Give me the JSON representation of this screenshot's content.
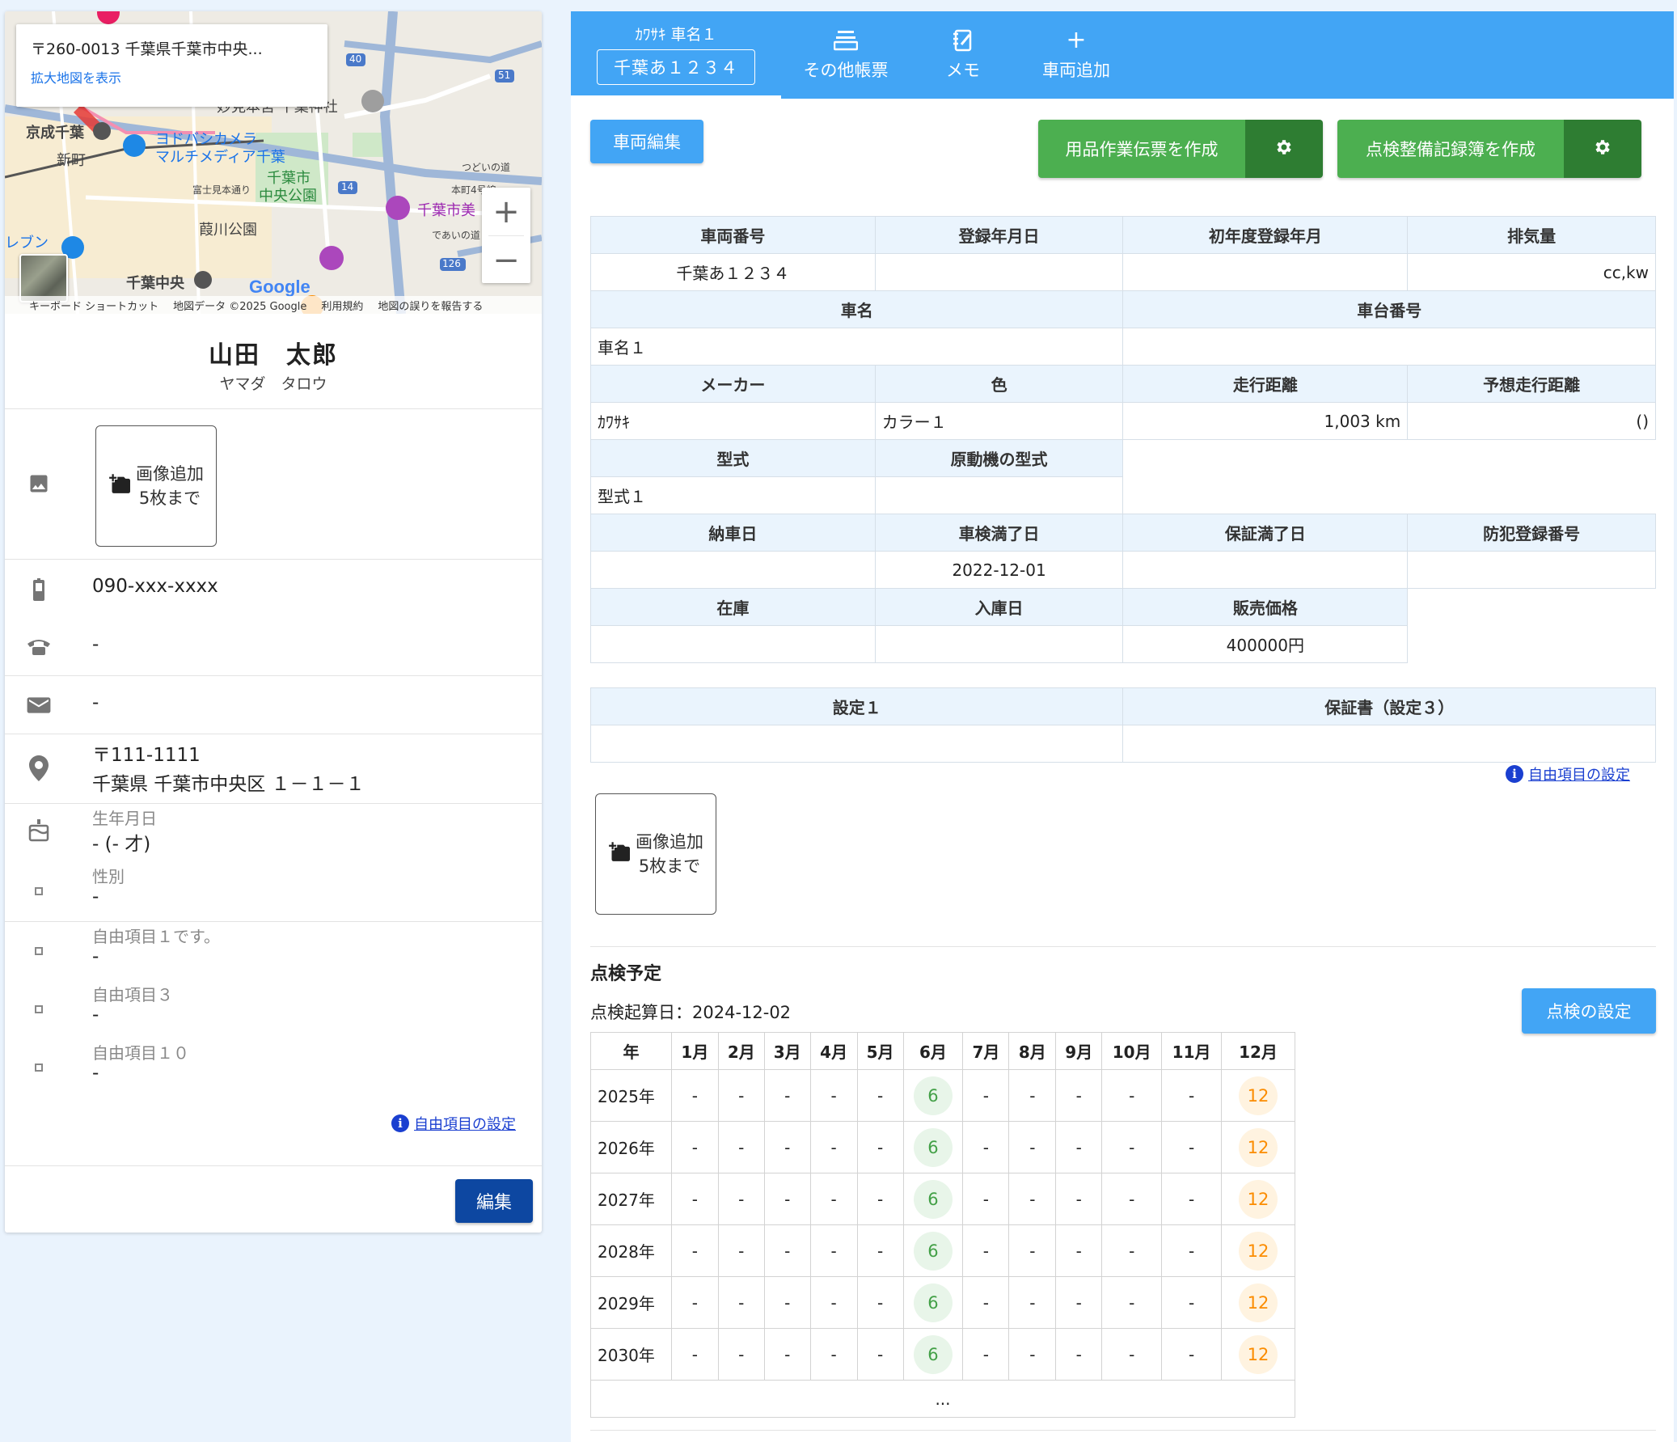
{
  "map": {
    "info_address": "〒260-0013 千葉県千葉市中央...",
    "info_link": "拡大地図を表示",
    "zoom_in": "+",
    "zoom_out": "−",
    "footer": [
      "キーボード ショートカット",
      "地図データ ©2025 Google",
      "利用規約",
      "地図の誤りを報告する"
    ],
    "logo": "Google",
    "labels": [
      "妙見本宮 千葉神社",
      "京成千葉",
      "新町",
      "ヨドバシカメラ",
      "マルチメディア千葉",
      "千葉市",
      "中央公園",
      "富士見本通り",
      "葭川公園",
      "千葉市美",
      "千葉中央",
      "レブン",
      "つどいの道",
      "本町4号線",
      "であいの道",
      "40",
      "51",
      "14",
      "126"
    ]
  },
  "customer": {
    "name": "山田　太郎",
    "kana": "ヤマダ　タロウ",
    "add_image": [
      "画像追加",
      "5枚まで"
    ],
    "mobile": "090-xxx-xxxx",
    "phone": "-",
    "email": "-",
    "postal": "〒111-1111",
    "address": "千葉県 千葉市中央区 １－１－１",
    "birthday_label": "生年月日",
    "birthday_value": "-  (- 才)",
    "gender_label": "性別",
    "gender_value": "-",
    "free1_label": "自由項目１です。",
    "free1_value": "-",
    "free3_label": "自由項目３",
    "free3_value": "-",
    "free10_label": "自由項目１０",
    "free10_value": "-",
    "free_settings_link": "自由項目の設定",
    "edit_button": "編集"
  },
  "tabs": {
    "active_sub": "ｶﾜｻｷ 車名１",
    "active_plate": "千葉あ１２３４",
    "other": "その他帳票",
    "memo": "メモ",
    "add_vehicle": "車両追加",
    "add_vehicle_icon": "+"
  },
  "actions": {
    "edit_vehicle": "車両編集",
    "supply_slip": "用品作業伝票を作成",
    "inspection_record": "点検整備記録簿を作成"
  },
  "vehicle": {
    "h_number": "車両番号",
    "h_reg_date": "登録年月日",
    "h_first_reg": "初年度登録年月",
    "h_displacement": "排気量",
    "number": "千葉あ１２３４",
    "reg_date": "",
    "first_reg": "",
    "displacement": "cc,kw",
    "h_car_name": "車名",
    "h_chassis": "車台番号",
    "car_name": "車名１",
    "chassis": "",
    "h_maker": "メーカー",
    "h_color": "色",
    "h_mileage": "走行距離",
    "h_expected_mileage": "予想走行距離",
    "maker": "ｶﾜｻｷ",
    "color": "カラー１",
    "mileage": "1,003 km",
    "expected_mileage": "()",
    "h_model": "型式",
    "h_engine_model": "原動機の型式",
    "model": "型式１",
    "engine_model": "",
    "h_delivery": "納車日",
    "h_inspection_expiry": "車検満了日",
    "h_warranty_expiry": "保証満了日",
    "h_security_reg": "防犯登録番号",
    "delivery": "",
    "inspection_expiry": "2022-12-01",
    "warranty_expiry": "",
    "security_reg": "",
    "h_stock": "在庫",
    "h_arrival": "入庫日",
    "h_price": "販売価格",
    "stock": "",
    "arrival": "",
    "price": "400000円"
  },
  "settings": {
    "h_setting1": "設定１",
    "h_warranty": "保証書（設定３）",
    "setting1": "",
    "warranty": "",
    "free_link": "自由項目の設定",
    "add_image": [
      "画像追加",
      "5枚まで"
    ]
  },
  "inspection": {
    "title": "点検予定",
    "base_date": "点検起算日：2024-12-02",
    "settings_button": "点検の設定",
    "columns": [
      "年",
      "1月",
      "2月",
      "3月",
      "4月",
      "5月",
      "6月",
      "7月",
      "8月",
      "9月",
      "10月",
      "11月",
      "12月"
    ],
    "rows": [
      {
        "year": "2025年",
        "cells": [
          "-",
          "-",
          "-",
          "-",
          "-",
          "6",
          "-",
          "-",
          "-",
          "-",
          "-",
          "12"
        ]
      },
      {
        "year": "2026年",
        "cells": [
          "-",
          "-",
          "-",
          "-",
          "-",
          "6",
          "-",
          "-",
          "-",
          "-",
          "-",
          "12"
        ]
      },
      {
        "year": "2027年",
        "cells": [
          "-",
          "-",
          "-",
          "-",
          "-",
          "6",
          "-",
          "-",
          "-",
          "-",
          "-",
          "12"
        ]
      },
      {
        "year": "2028年",
        "cells": [
          "-",
          "-",
          "-",
          "-",
          "-",
          "6",
          "-",
          "-",
          "-",
          "-",
          "-",
          "12"
        ]
      },
      {
        "year": "2029年",
        "cells": [
          "-",
          "-",
          "-",
          "-",
          "-",
          "6",
          "-",
          "-",
          "-",
          "-",
          "-",
          "12"
        ]
      },
      {
        "year": "2030年",
        "cells": [
          "-",
          "-",
          "-",
          "-",
          "-",
          "6",
          "-",
          "-",
          "-",
          "-",
          "-",
          "12"
        ]
      }
    ],
    "more": "...",
    "colors": {
      "june": "#43a047",
      "december": "#fb8c00"
    }
  },
  "colors": {
    "tab_bar": "#42a5f5",
    "green_button": "#4caf50",
    "green_gear": "#2e7d32",
    "edit_button": "#0d47a1",
    "link": "#1a3fd0"
  }
}
